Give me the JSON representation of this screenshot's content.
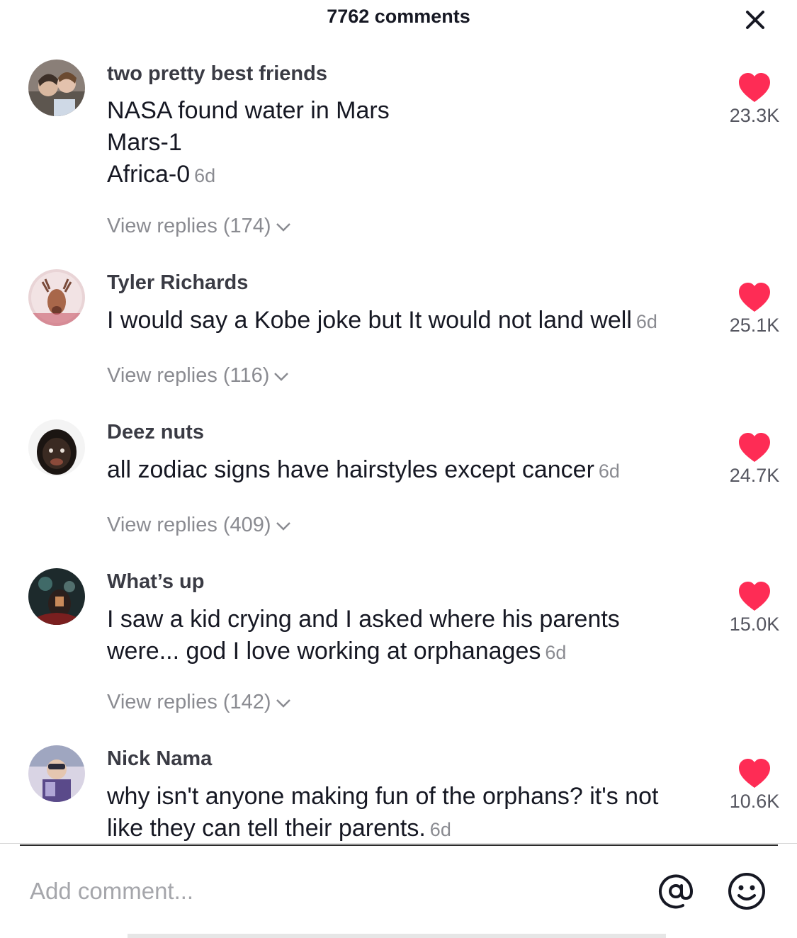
{
  "header": {
    "title": "7762 comments",
    "close_icon": "close-icon"
  },
  "comments": [
    {
      "username": "two pretty best friends",
      "lines": [
        "NASA found water in Mars",
        "Mars-1",
        "Africa-0"
      ],
      "time": "6d",
      "replies": "View replies (174)",
      "likes": "23.3K"
    },
    {
      "username": "Tyler Richards",
      "lines": [
        "I would say a Kobe joke but It would not land well"
      ],
      "time": "6d",
      "replies": "View replies (116)",
      "likes": "25.1K"
    },
    {
      "username": "Deez nuts",
      "lines": [
        "all zodiac signs have hairstyles except cancer"
      ],
      "time": "6d",
      "replies": "View replies (409)",
      "likes": "24.7K"
    },
    {
      "username": "What’s up",
      "lines": [
        "I saw a kid crying and I asked where his parents",
        "were... god I love working at orphanages"
      ],
      "time": "6d",
      "replies": "View replies (142)",
      "likes": "15.0K"
    },
    {
      "username": "Nick Nama",
      "lines": [
        "why isn't anyone making fun of the orphans? it's not",
        "like they can tell their parents."
      ],
      "time": "6d",
      "likes": "10.6K"
    }
  ],
  "input": {
    "placeholder": "Add comment..."
  },
  "icons": {
    "like": "heart-icon",
    "expand": "chevron-down-icon",
    "mention": "at-sign-icon",
    "emoji": "smiley-icon"
  },
  "colors": {
    "heart": "#fe2c55",
    "muted": "#8a8b91"
  }
}
